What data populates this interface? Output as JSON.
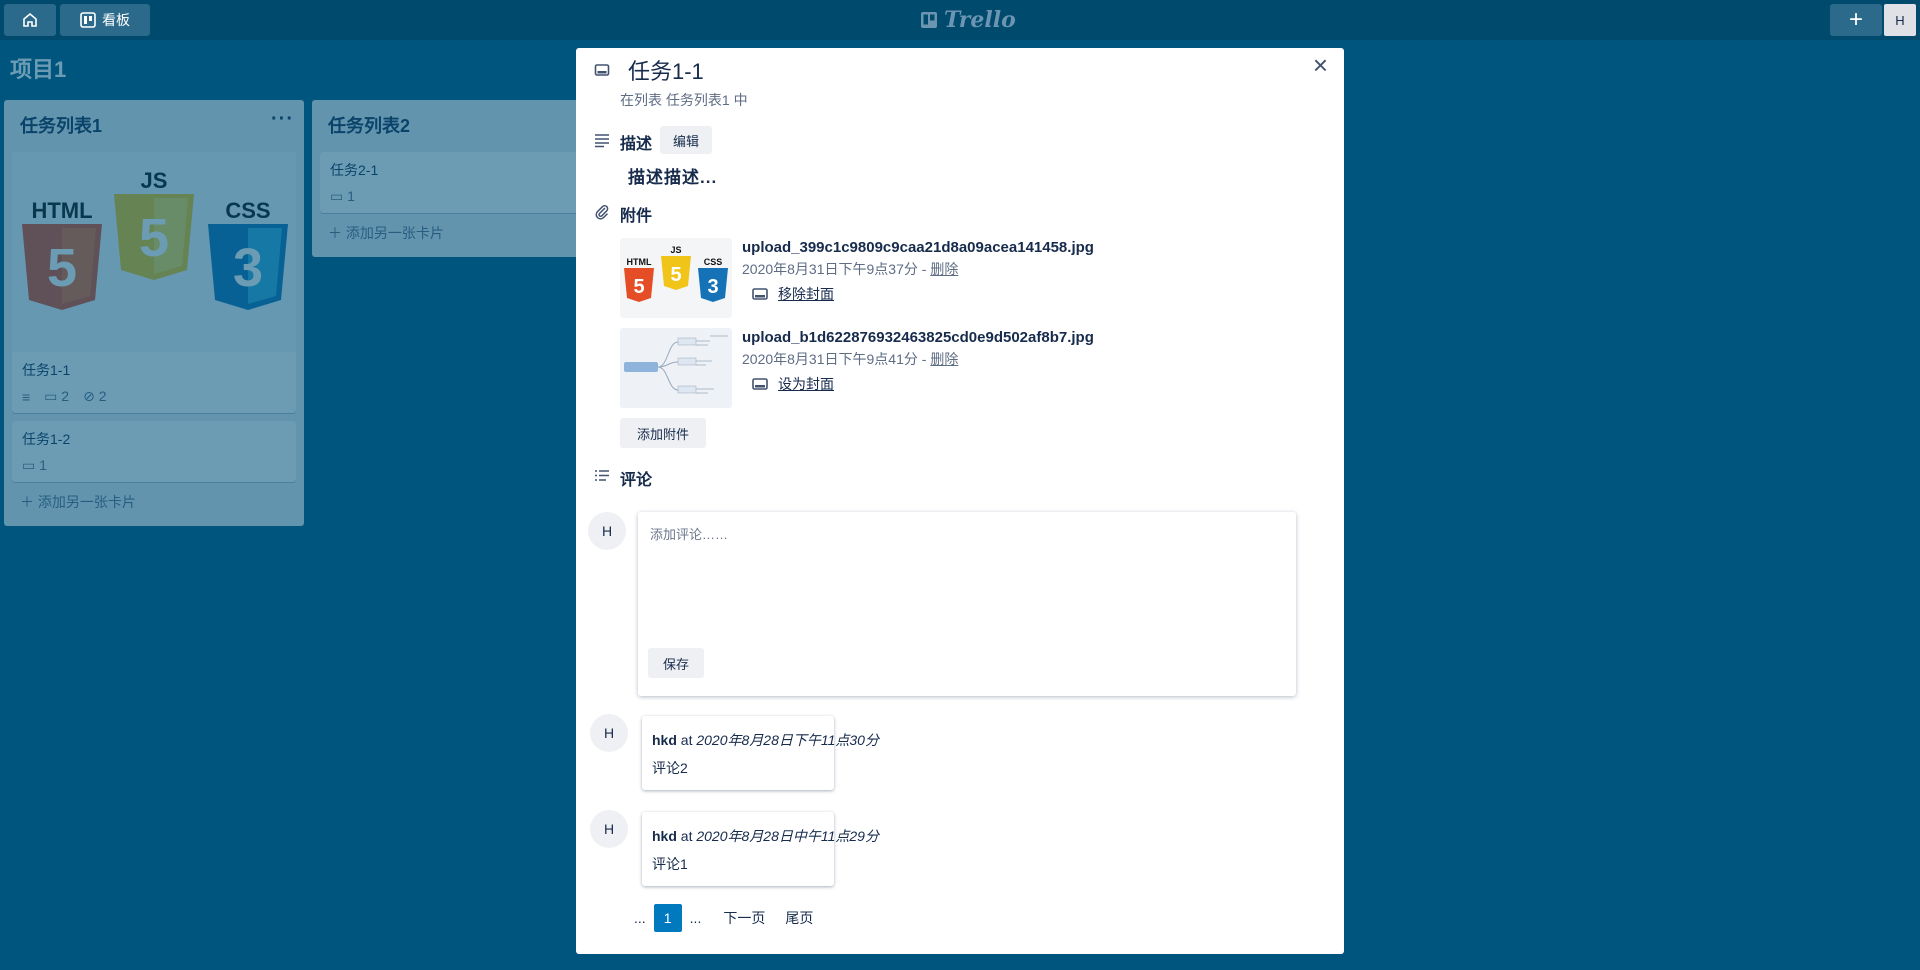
{
  "topbar": {
    "board_button_label": "看板",
    "logo_text": "Trello",
    "avatar_initial": "H",
    "add_label": "+"
  },
  "board": {
    "title": "项目1"
  },
  "lists": [
    {
      "title": "任务列表1",
      "menu": "···",
      "cards": [
        {
          "title": "任务1-1",
          "comments": "2",
          "attachments": "2"
        },
        {
          "title": "任务1-2",
          "comments": "1"
        }
      ],
      "add_card": "添加另一张卡片"
    },
    {
      "title": "任务列表2",
      "cards": [
        {
          "title": "任务2-1",
          "comments": "1"
        }
      ],
      "add_card": "添加另一张卡片"
    }
  ],
  "cover_logos": {
    "html": "HTML",
    "js": "JS",
    "css": "CSS",
    "html_num": "5",
    "js_num": "5",
    "css_num": "3"
  },
  "modal": {
    "title": "任务1-1",
    "subtitle": "在列表 任务列表1 中",
    "close": "×",
    "description": {
      "heading": "描述",
      "edit_label": "编辑",
      "text": "描述描述..."
    },
    "attachments": {
      "heading": "附件",
      "items": [
        {
          "name": "upload_399c1c9809c9caa21d8a09acea141458.jpg",
          "date": "2020年8月31日下午9点37分",
          "sep": " - ",
          "delete_label": "删除",
          "action_label": "移除封面"
        },
        {
          "name": "upload_b1d622876932463825cd0e9d502af8b7.jpg",
          "date": "2020年8月31日下午9点41分",
          "sep": " - ",
          "delete_label": "删除",
          "action_label": "设为封面"
        }
      ],
      "add_label": "添加附件"
    },
    "comments": {
      "heading": "评论",
      "input_avatar": "H",
      "placeholder": "添加评论……",
      "save_label": "保存",
      "items": [
        {
          "avatar": "H",
          "author": "hkd",
          "at": " at ",
          "time": "2020年8月28日下午11点30分",
          "text": "评论2"
        },
        {
          "avatar": "H",
          "author": "hkd",
          "at": " at ",
          "time": "2020年8月28日中午11点29分",
          "text": "评论1"
        }
      ]
    },
    "pagination": {
      "prev_ellipsis": "...",
      "current": "1",
      "next_ellipsis": "...",
      "next_label": "下一页",
      "last_label": "尾页"
    }
  },
  "colors": {
    "background": "#00557e",
    "topbar": "#004a6e",
    "accent": "#0079bf",
    "html_orange": "#e44d26",
    "js_yellow": "#f0c419",
    "css_blue": "#1572b6"
  },
  "icons": {
    "home": "home-icon",
    "board": "board-icon",
    "card": "card-icon",
    "description": "description-icon",
    "attachment": "paperclip-icon",
    "activity": "activity-icon",
    "comment": "comment-icon",
    "plus": "plus-icon",
    "close": "close-icon"
  }
}
